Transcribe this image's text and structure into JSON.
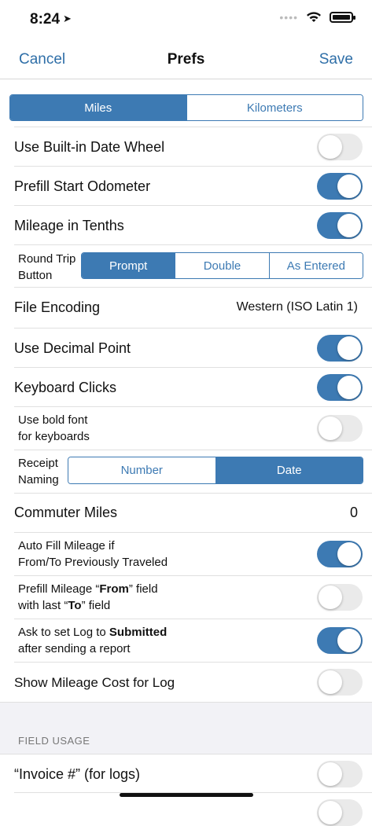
{
  "status": {
    "time": "8:24"
  },
  "nav": {
    "cancel": "Cancel",
    "title": "Prefs",
    "save": "Save"
  },
  "units": {
    "options": [
      "Miles",
      "Kilometers"
    ],
    "selected": "Miles"
  },
  "rows": {
    "date_wheel": {
      "label": "Use Built-in Date Wheel",
      "on": false
    },
    "prefill_odometer": {
      "label": "Prefill Start Odometer",
      "on": true
    },
    "tenths": {
      "label": "Mileage in Tenths",
      "on": true
    },
    "round_trip": {
      "label_line1": "Round Trip",
      "label_line2": "Button",
      "options": [
        "Prompt",
        "Double",
        "As Entered"
      ],
      "selected": "Prompt"
    },
    "file_encoding": {
      "label": "File Encoding",
      "value": "Western (ISO Latin 1)"
    },
    "decimal_point": {
      "label": "Use Decimal Point",
      "on": true
    },
    "keyboard_clicks": {
      "label": "Keyboard Clicks",
      "on": true
    },
    "bold_font": {
      "label_line1": "Use bold font",
      "label_line2": "for keyboards",
      "on": false
    },
    "receipt_naming": {
      "label_line1": "Receipt",
      "label_line2": "Naming",
      "options": [
        "Number",
        "Date"
      ],
      "selected": "Date"
    },
    "commuter_miles": {
      "label": "Commuter Miles",
      "value": "0"
    },
    "auto_fill": {
      "label_line1": "Auto Fill Mileage if",
      "label_line2": "From/To Previously Traveled",
      "on": true
    },
    "prefill_from": {
      "line1_a": "Prefill Mileage “",
      "line1_b": "From",
      "line1_c": "” field",
      "line2_a": "with last “",
      "line2_b": "To",
      "line2_c": "” field",
      "on": false
    },
    "submitted": {
      "line1_a": "Ask to set Log to ",
      "line1_b": "Submitted",
      "line2": "after sending a report",
      "on": true
    },
    "mileage_cost": {
      "label": "Show Mileage Cost for Log",
      "on": false
    }
  },
  "field_usage": {
    "header": "FIELD USAGE",
    "invoice": {
      "label": "“Invoice #” (for logs)",
      "on": false
    }
  },
  "colors": {
    "accent": "#3d7ab3",
    "link": "#2f6fa8"
  }
}
